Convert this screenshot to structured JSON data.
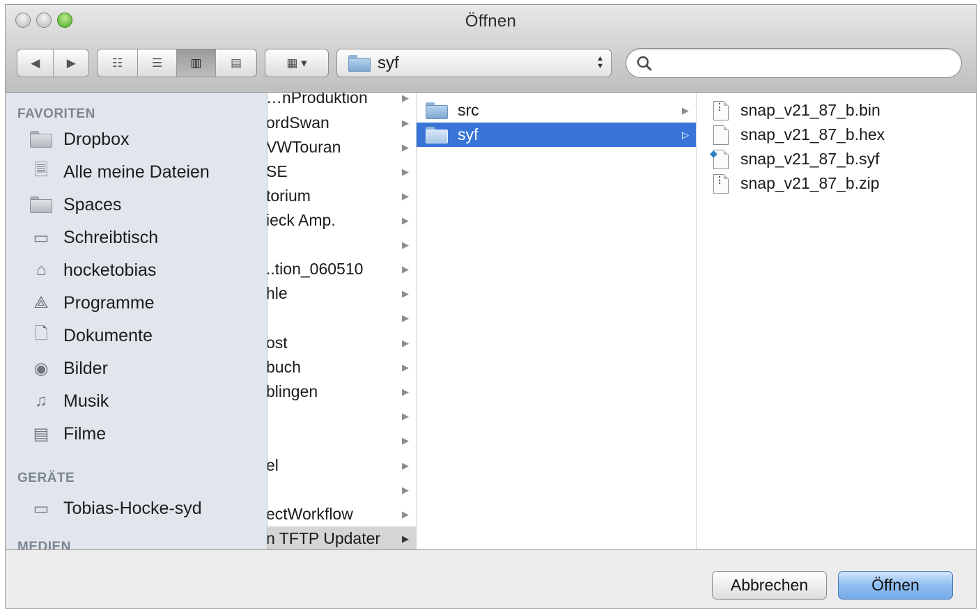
{
  "window": {
    "title": "Öffnen"
  },
  "toolbar": {
    "nav": {
      "back_icon": "◀",
      "forward_icon": "▶"
    },
    "views": {
      "icons": "☷",
      "list": "☰",
      "columns": "▥",
      "coverflow": "▤"
    },
    "arrange_icon": "▦ ▾",
    "path": "syf",
    "search_placeholder": ""
  },
  "sidebar": {
    "favorites_header": "FAVORITEN",
    "favorites": [
      {
        "label": "Dropbox",
        "icon": "folder-icon"
      },
      {
        "label": "Alle meine Dateien",
        "icon": "all-files-icon"
      },
      {
        "label": "Spaces",
        "icon": "folder-icon"
      },
      {
        "label": "Schreibtisch",
        "icon": "desktop-icon"
      },
      {
        "label": "hocketobias",
        "icon": "home-icon"
      },
      {
        "label": "Programme",
        "icon": "applications-icon"
      },
      {
        "label": "Dokumente",
        "icon": "documents-icon"
      },
      {
        "label": "Bilder",
        "icon": "camera-icon"
      },
      {
        "label": "Musik",
        "icon": "music-icon"
      },
      {
        "label": "Filme",
        "icon": "film-icon"
      }
    ],
    "devices_header": "GERÄTE",
    "devices": [
      {
        "label": "Tobias-Hocke-syd",
        "icon": "laptop-icon"
      }
    ],
    "media_header": "MEDIEN"
  },
  "columns": {
    "col1": [
      "…nProduktion",
      "ordSwan",
      "VWTouran",
      "SE",
      "torium",
      "ieck Amp.",
      "",
      "..tion_060510",
      "hle",
      "",
      "ost",
      "buch",
      "blingen",
      "",
      "",
      "el",
      "",
      "ectWorkflow",
      "n TFTP Updater"
    ],
    "col2": [
      {
        "label": "src"
      },
      {
        "label": "syf",
        "selected": true
      }
    ],
    "col3": [
      {
        "label": "snap_v21_87_b.bin",
        "kind": "archive"
      },
      {
        "label": "snap_v21_87_b.hex",
        "kind": "doc"
      },
      {
        "label": "snap_v21_87_b.syf",
        "kind": "special"
      },
      {
        "label": "snap_v21_87_b.zip",
        "kind": "archive"
      }
    ]
  },
  "buttons": {
    "cancel": "Abbrechen",
    "open": "Öffnen"
  },
  "colors": {
    "selection": "#3875d7",
    "sidebar_bg": "#e1e6ed",
    "default_button": "#76ace9"
  }
}
